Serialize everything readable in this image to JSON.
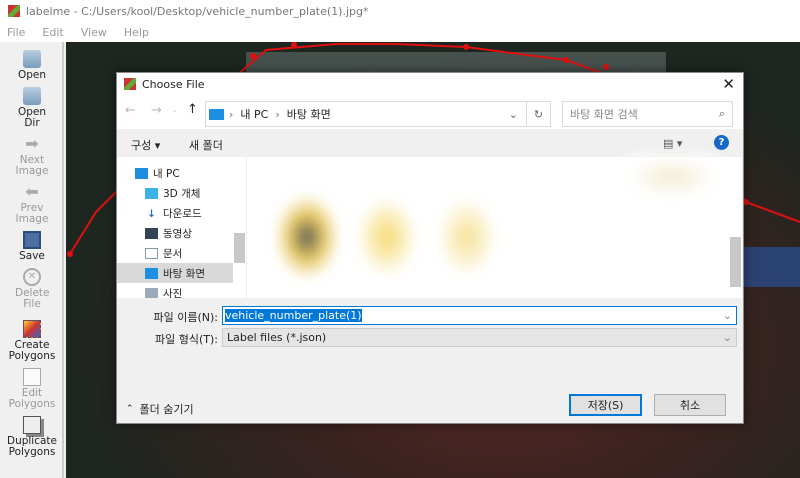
{
  "window": {
    "title": "labelme - C:/Users/kool/Desktop/vehicle_number_plate(1).jpg*"
  },
  "menu": [
    "File",
    "Edit",
    "View",
    "Help"
  ],
  "toolbar": [
    {
      "label": "Open",
      "icon": "folder-icon",
      "enabled": true
    },
    {
      "label": "Open Dir",
      "icon": "folder-icon",
      "enabled": true
    },
    {
      "label": "Next Image",
      "icon": "arrow-right-icon",
      "enabled": false
    },
    {
      "label": "Prev Image",
      "icon": "arrow-left-icon",
      "enabled": false
    },
    {
      "label": "Save",
      "icon": "floppy-icon",
      "enabled": true
    },
    {
      "label": "Delete File",
      "icon": "delete-icon",
      "enabled": false
    },
    {
      "label": "Create Polygons",
      "icon": "create-polygon-icon",
      "enabled": true
    },
    {
      "label": "Edit Polygons",
      "icon": "edit-icon",
      "enabled": false
    },
    {
      "label": "Duplicate Polygons",
      "icon": "duplicate-icon",
      "enabled": true
    }
  ],
  "dialog": {
    "title": "Choose File",
    "breadcrumb": [
      "내 PC",
      "바탕 화면"
    ],
    "search_placeholder": "바탕 화면 검색",
    "organize": "구성 ▾",
    "new_folder": "새 폴더",
    "nav": [
      {
        "label": "내 PC",
        "level": 0
      },
      {
        "label": "3D 개체",
        "level": 1
      },
      {
        "label": "다운로드",
        "level": 1
      },
      {
        "label": "동영상",
        "level": 1
      },
      {
        "label": "문서",
        "level": 1
      },
      {
        "label": "바탕 화면",
        "level": 1,
        "selected": true
      },
      {
        "label": "사진",
        "level": 1
      }
    ],
    "filename_label": "파일 이름(N):",
    "filename_value": "vehicle_number_plate(1)",
    "filetype_label": "파일 형식(T):",
    "filetype_value": "Label files (*.json)",
    "hide_folders": "폴더 숨기기",
    "save": "저장(S)",
    "cancel": "취소"
  }
}
